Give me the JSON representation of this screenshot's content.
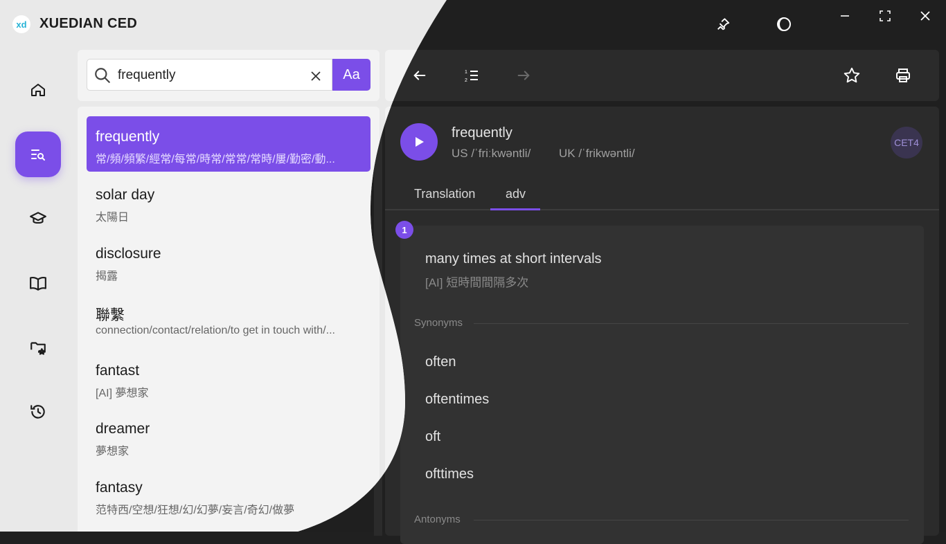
{
  "app": {
    "title": "XUEDIAN CED",
    "logo_text": "xd"
  },
  "search": {
    "value": "frequently",
    "placeholder": "",
    "mode_button": "Aa"
  },
  "results": [
    {
      "word": "frequently",
      "def": "常/頻/頻繁/經常/每常/時常/常常/常時/屢/勤密/動..."
    },
    {
      "word": "solar day",
      "def": "太陽日"
    },
    {
      "word": "disclosure",
      "def": "揭露"
    },
    {
      "word": "聯繫",
      "def": "connection/contact/relation/to get in touch with/..."
    },
    {
      "word": "fantast",
      "def": "[AI] 夢想家"
    },
    {
      "word": "dreamer",
      "def": "夢想家"
    },
    {
      "word": "fantasy",
      "def": "范特西/空想/狂想/幻/幻夢/妄言/奇幻/做夢"
    }
  ],
  "entry": {
    "word": "frequently",
    "us_phonetic": "US /ˈfriːkwəntli/",
    "uk_phonetic": "UK /ˈfrikwəntli/",
    "level_badge": "CET4",
    "tabs": [
      "Translation",
      "adv"
    ],
    "sense": {
      "number": "1",
      "definition": "many times at short intervals",
      "translation": "[AI] 短時間間隔多次",
      "synonyms_label": "Synonyms",
      "synonyms": [
        "often",
        "oftentimes",
        "oft",
        "ofttimes"
      ],
      "antonyms_label": "Antonyms"
    }
  },
  "icons": {
    "nav": [
      "home-icon",
      "search-list-icon",
      "graduation-cap-icon",
      "book-icon",
      "folder-star-icon",
      "history-icon"
    ],
    "toolbar": [
      "back-arrow-icon",
      "numbered-list-icon",
      "forward-arrow-icon",
      "star-icon",
      "printer-icon"
    ],
    "window": [
      "pin-icon",
      "theme-icon",
      "minimize-icon",
      "fullscreen-icon",
      "close-icon"
    ]
  },
  "colors": {
    "accent": "#7b4ee8",
    "dark_bg": "#1f1f1f",
    "light_bg": "#e9e9e9"
  }
}
